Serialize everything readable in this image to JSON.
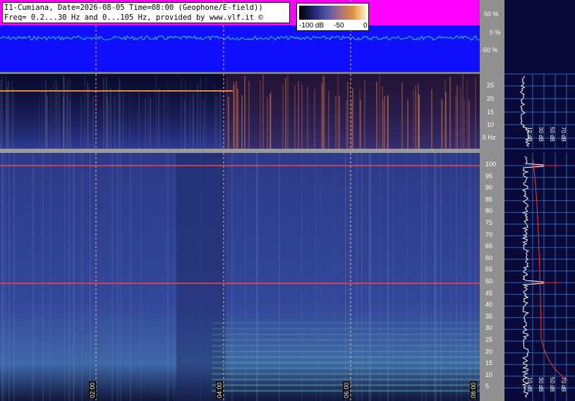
{
  "header": {
    "line1": "I1-Cumiana, Date=2026-08-05 Time=08:00 (Geophone/E-field))",
    "line2": "Freq= 0.2...30 Hz and 0...105 Hz, provided by www.vlf.it ©"
  },
  "colorbar": {
    "label_min": "-100 dB",
    "label_mid": "-50",
    "label_max": "0"
  },
  "top_axis": {
    "labels": [
      "50 %",
      "0 %",
      "-50 %"
    ]
  },
  "low_axis": {
    "labels": [
      "25",
      "20",
      "15",
      "10",
      "5 Hz"
    ]
  },
  "high_axis": {
    "labels": [
      "100",
      "95",
      "90",
      "85",
      "80",
      "75",
      "70",
      "65",
      "60",
      "55",
      "50",
      "45",
      "40",
      "35",
      "30",
      "25",
      "20",
      "15",
      "10",
      "5"
    ]
  },
  "time_axis": {
    "labels": [
      "02:00",
      "04:00",
      "06:00",
      "08:00"
    ]
  },
  "right_panel": {
    "low_labels": [
      "10 dB",
      "30 dB",
      "50 dB",
      "70 dB"
    ],
    "high_labels": [
      "10 dB",
      "30 dB",
      "50 dB",
      "70 dB"
    ]
  },
  "colors": {
    "amplitude_bg": "#1010ff",
    "amplitude_fill": "#ff00ff",
    "amplitude_trace": "#20d0d0",
    "spectrogram_low_bg": "#0a0a2a",
    "spectrogram_high_bg": "#2c3d8c",
    "hum_line": "#ff4040",
    "grid": "#40a0ff"
  }
}
